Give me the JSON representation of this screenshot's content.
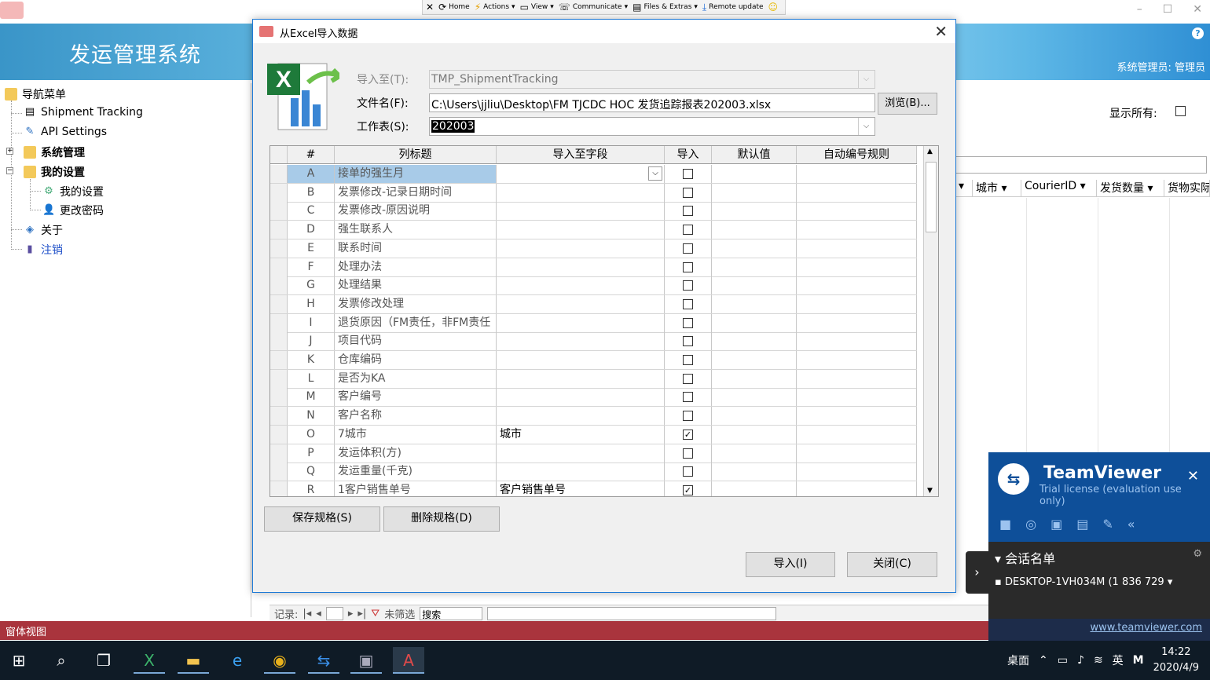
{
  "remote_toolbar": {
    "items": [
      "Home",
      "Actions",
      "View",
      "Communicate",
      "Files & Extras",
      "Remote update"
    ]
  },
  "app": {
    "title": "发运管理系统",
    "user_label": "系统管理员: 管理员",
    "help": "?"
  },
  "nav": {
    "root": "导航菜单",
    "items": [
      "Shipment Tracking",
      "API Settings",
      "系统管理",
      "我的设置",
      "我的设置",
      "更改密码",
      "关于",
      "注销"
    ]
  },
  "bg_pane": {
    "show_all_label": "显示所有:",
    "columns": [
      "",
      "城市",
      "CourierID",
      "发货数量",
      "货物实际"
    ]
  },
  "record_nav": {
    "label": "记录:",
    "filter_label": "未筛选",
    "search_label": "搜索"
  },
  "status_bar": {
    "text": "窗体视图"
  },
  "dialog": {
    "title": "从Excel导入数据",
    "close": "✕",
    "import_to_label": "导入至(T):",
    "import_to_value": "TMP_ShipmentTracking",
    "filename_label": "文件名(F):",
    "filename_value": "C:\\Users\\jjliu\\Desktop\\FM TJCDC HOC 发货追踪报表202003.xlsx",
    "browse_button": "浏览(B)...",
    "sheet_label": "工作表(S):",
    "sheet_value": "202003",
    "grid_headers": [
      "#",
      "列标题",
      "导入至字段",
      "导入",
      "默认值",
      "自动编号规则"
    ],
    "rows": [
      {
        "num": "A",
        "title": "接单的强生月",
        "field": "",
        "checked": false
      },
      {
        "num": "B",
        "title": "发票修改-记录日期时间",
        "field": "",
        "checked": false
      },
      {
        "num": "C",
        "title": "发票修改-原因说明",
        "field": "",
        "checked": false
      },
      {
        "num": "D",
        "title": "强生联系人",
        "field": "",
        "checked": false
      },
      {
        "num": "E",
        "title": "联系时间",
        "field": "",
        "checked": false
      },
      {
        "num": "F",
        "title": "处理办法",
        "field": "",
        "checked": false
      },
      {
        "num": "G",
        "title": "处理结果",
        "field": "",
        "checked": false
      },
      {
        "num": "H",
        "title": "发票修改处理",
        "field": "",
        "checked": false
      },
      {
        "num": "I",
        "title": "退货原因（FM责任，非FM责任",
        "field": "",
        "checked": false
      },
      {
        "num": "J",
        "title": "项目代码",
        "field": "",
        "checked": false
      },
      {
        "num": "K",
        "title": "仓库编码",
        "field": "",
        "checked": false
      },
      {
        "num": "L",
        "title": "是否为KA",
        "field": "",
        "checked": false
      },
      {
        "num": "M",
        "title": "客户编号",
        "field": "",
        "checked": false
      },
      {
        "num": "N",
        "title": "客户名称",
        "field": "",
        "checked": false
      },
      {
        "num": "O",
        "title": "7城市",
        "field": "城市",
        "checked": true
      },
      {
        "num": "P",
        "title": "发运体积(方)",
        "field": "",
        "checked": false
      },
      {
        "num": "Q",
        "title": "发运重量(千克)",
        "field": "",
        "checked": false
      },
      {
        "num": "R",
        "title": "1客户销售单号",
        "field": "客户销售单号",
        "checked": true
      }
    ],
    "save_spec_button": "保存规格(S)",
    "delete_spec_button": "删除规格(D)",
    "import_button": "导入(I)",
    "close_button": "关闭(C)"
  },
  "teamviewer": {
    "name": "TeamViewer",
    "license": "Trial license (evaluation use only)",
    "session_list": "会话名单",
    "device": "DESKTOP-1VH034M (1 836 729",
    "link": "www.teamviewer.com"
  },
  "taskbar": {
    "desktop_label": "桌面",
    "ime": "英",
    "time": "14:22",
    "date": "2020/4/9"
  }
}
